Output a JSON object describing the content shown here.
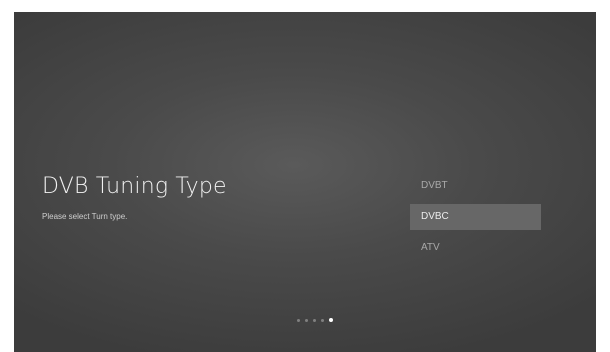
{
  "page": {
    "title": "DVB Tuning Type",
    "subtitle": "Please select Turn type."
  },
  "options": [
    {
      "label": "DVBT",
      "selected": false
    },
    {
      "label": "DVBC",
      "selected": true
    },
    {
      "label": "ATV",
      "selected": false
    }
  ],
  "pagination": {
    "total_steps": 5,
    "current_step": 5
  }
}
